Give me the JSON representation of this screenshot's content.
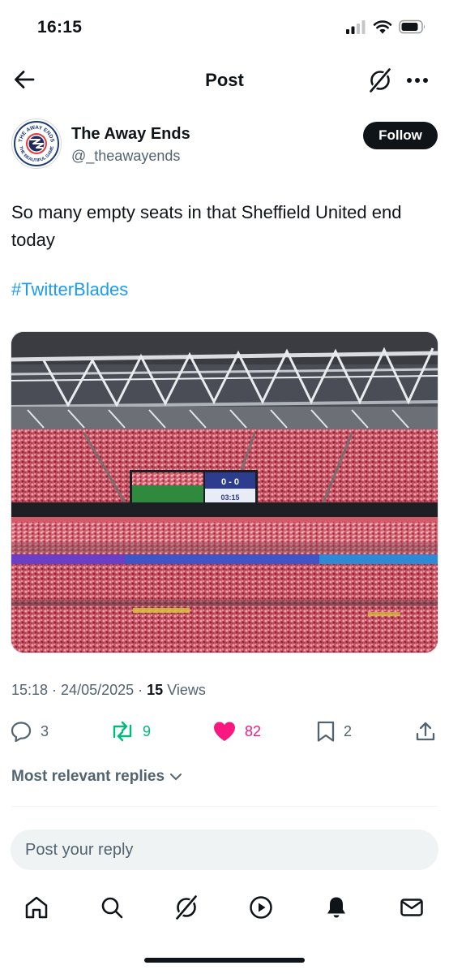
{
  "status_bar": {
    "time": "16:15"
  },
  "nav": {
    "title": "Post"
  },
  "author": {
    "name": "The Away Ends",
    "handle": "@_theawayends",
    "avatar_text_top": "THE AWAY ENDS",
    "avatar_text_bottom": "THE BEAUTIFUL GAME",
    "follow_label": "Follow"
  },
  "post": {
    "text": "So many empty seats in that Sheffield United end today",
    "hashtag": "#TwitterBlades",
    "image": {
      "scoreboard_score": "0 - 0",
      "scoreboard_clock": "03:15"
    }
  },
  "meta": {
    "time": "15:18",
    "date": "24/05/2025",
    "views_count": "15",
    "views_label": "Views"
  },
  "actions": {
    "replies": "3",
    "reposts": "9",
    "likes": "82",
    "bookmarks": "2"
  },
  "replies_sort": {
    "label": "Most relevant replies"
  },
  "reply_input": {
    "placeholder": "Post your reply"
  },
  "colors": {
    "accent": "#1d9bf0",
    "repost": "#00ba7c",
    "like": "#f91880",
    "muted": "#536471",
    "text": "#0f1419"
  },
  "icons": {
    "tabs": [
      "home-icon",
      "search-icon",
      "grok-icon",
      "video-icon",
      "notifications-icon",
      "messages-icon"
    ]
  }
}
